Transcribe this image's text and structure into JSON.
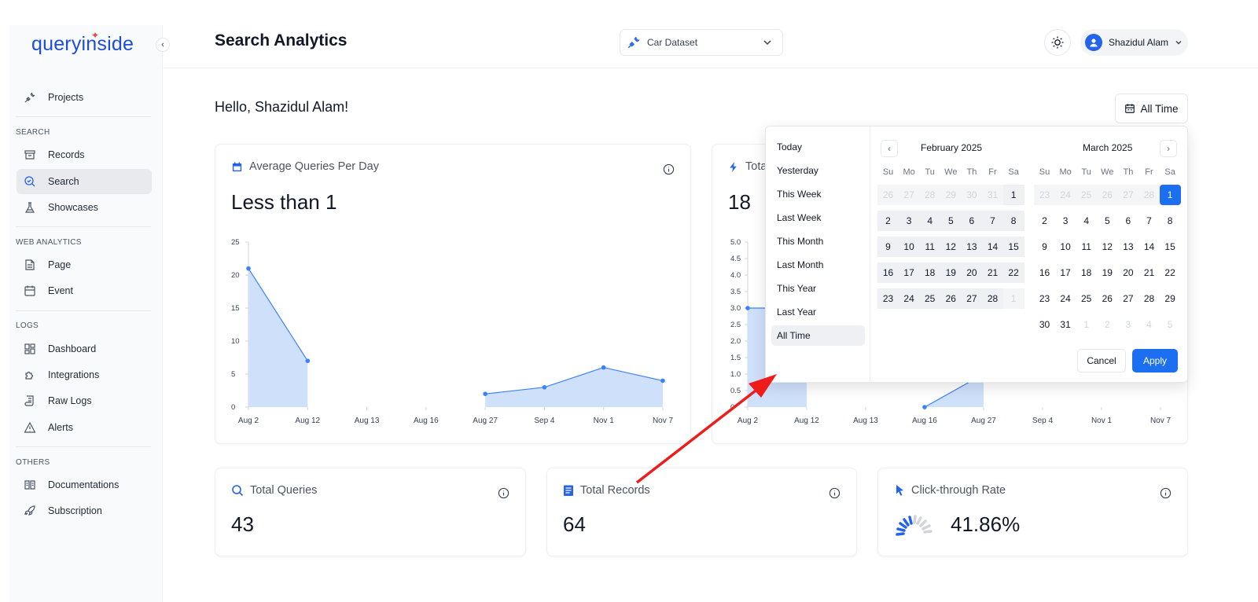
{
  "app": {
    "logo": "queryinside",
    "page_title": "Search Analytics",
    "greeting": "Hello, Shazidul Alam!"
  },
  "header": {
    "dataset": "Car Dataset",
    "user_name": "Shazidul Alam",
    "range_button": "All Time"
  },
  "sidebar": {
    "projects": "Projects",
    "sections": {
      "search": "SEARCH",
      "web_analytics": "WEB ANALYTICS",
      "logs": "LOGS",
      "others": "OTHERS"
    },
    "items": {
      "records": "Records",
      "search": "Search",
      "showcases": "Showcases",
      "page": "Page",
      "event": "Event",
      "dashboard": "Dashboard",
      "integrations": "Integrations",
      "raw_logs": "Raw Logs",
      "alerts": "Alerts",
      "documentations": "Documentations",
      "subscription": "Subscription"
    }
  },
  "cards": {
    "avg": {
      "title": "Average Queries Per Day",
      "value": "Less than 1"
    },
    "total_trend": {
      "title": "Tota",
      "value": "18"
    },
    "total_queries": {
      "title": "Total Queries",
      "value": "43"
    },
    "total_records": {
      "title": "Total Records",
      "value": "64"
    },
    "ctr": {
      "title": "Click-through Rate",
      "value": "41.86%"
    }
  },
  "chart_data": [
    {
      "type": "area",
      "x": [
        "Aug 2",
        "Aug 12",
        "Aug 13",
        "Aug 16",
        "Aug 27",
        "Sep 4",
        "Nov 1",
        "Nov 7"
      ],
      "series": [
        {
          "values": [
            21,
            7,
            null,
            null,
            2,
            3,
            6,
            4
          ]
        }
      ],
      "yticks": [
        "0",
        "5",
        "10",
        "15",
        "20",
        "25"
      ],
      "ylim": [
        0,
        25
      ],
      "color": "#3b82f6"
    },
    {
      "type": "area",
      "x": [
        "Aug 2",
        "Aug 12",
        "Aug 13",
        "Aug 16",
        "Aug 27",
        "Sep 4",
        "Nov 1",
        "Nov 7"
      ],
      "series": [
        {
          "values": [
            3,
            3,
            null,
            0,
            1,
            null,
            null,
            null
          ]
        }
      ],
      "yticks": [
        "0",
        "0.5",
        "1.0",
        "1.5",
        "2.0",
        "2.5",
        "3.0",
        "3.5",
        "4.0",
        "4.5",
        "5.0"
      ],
      "ylim": [
        0,
        5
      ],
      "color": "#3b82f6"
    }
  ],
  "date_picker": {
    "presets": [
      "Today",
      "Yesterday",
      "This Week",
      "Last Week",
      "This Month",
      "Last Month",
      "This Year",
      "Last Year",
      "All Time"
    ],
    "selected_preset": "All Time",
    "weekdays": [
      "Su",
      "Mo",
      "Tu",
      "We",
      "Th",
      "Fr",
      "Sa"
    ],
    "left_month": "February 2025",
    "right_month": "March 2025",
    "left_days": [
      "26",
      "27",
      "28",
      "29",
      "30",
      "31",
      "1",
      "2",
      "3",
      "4",
      "5",
      "6",
      "7",
      "8",
      "9",
      "10",
      "11",
      "12",
      "13",
      "14",
      "15",
      "16",
      "17",
      "18",
      "19",
      "20",
      "21",
      "22",
      "23",
      "24",
      "25",
      "26",
      "27",
      "28",
      "1"
    ],
    "right_days": [
      "23",
      "24",
      "25",
      "26",
      "27",
      "28",
      "1",
      "2",
      "3",
      "4",
      "5",
      "6",
      "7",
      "8",
      "9",
      "10",
      "11",
      "12",
      "13",
      "14",
      "15",
      "16",
      "17",
      "18",
      "19",
      "20",
      "21",
      "22",
      "23",
      "24",
      "25",
      "26",
      "27",
      "28",
      "29",
      "30",
      "31",
      "1",
      "2",
      "3",
      "4",
      "5"
    ],
    "cancel": "Cancel",
    "apply": "Apply",
    "prev_glyph": "‹",
    "next_glyph": "›"
  },
  "colors": {
    "accent": "#1d6ff2",
    "chart_fill": "#cfe0fb",
    "chart_line": "#3b82f6",
    "arrow": "#ef1c1c"
  }
}
